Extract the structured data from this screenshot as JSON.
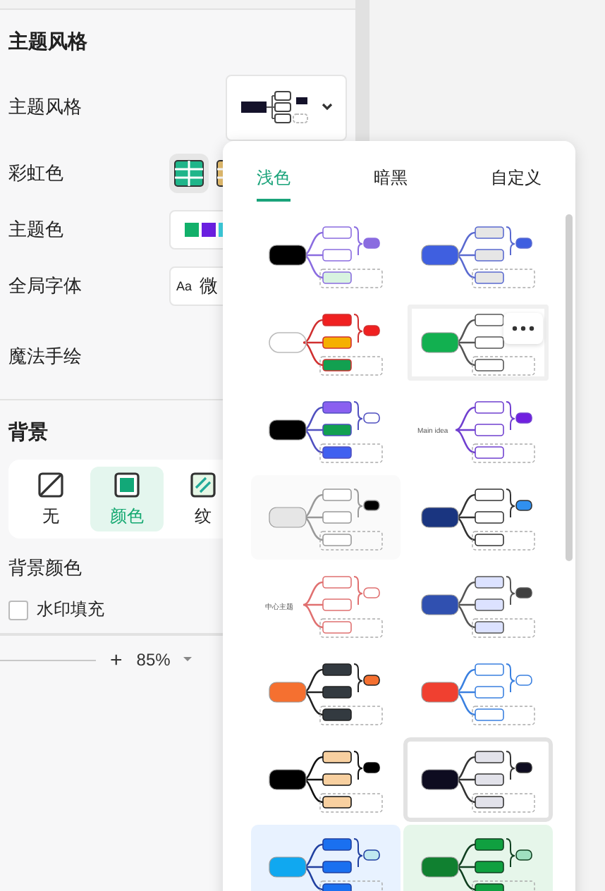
{
  "style_panel": {
    "heading": "主题风格",
    "theme_style": {
      "label": "主题风格"
    },
    "rainbow": {
      "label": "彩虹色",
      "options": [
        {
          "selected": true
        },
        {
          "selected": false
        }
      ]
    },
    "theme_color": {
      "label": "主题色",
      "swatches": [
        {
          "color": "#12b06a"
        },
        {
          "color": "#6a1fe0"
        },
        {
          "color": "#3dd0e0"
        }
      ]
    },
    "font": {
      "label": "全局字体",
      "icon": "Aa",
      "value": "微"
    },
    "hand_drawn": {
      "label": "魔法手绘"
    }
  },
  "background": {
    "heading": "背景",
    "options": [
      {
        "kind": "none",
        "label": "无",
        "selected": false
      },
      {
        "kind": "color",
        "label": "颜色",
        "selected": true
      },
      {
        "kind": "texture",
        "label": "纹",
        "selected": false
      }
    ],
    "color_label": "背景颜色",
    "watermark": {
      "label": "水印填充",
      "checked": false
    }
  },
  "zoom": {
    "plus": "+",
    "value": "85%"
  },
  "theme_popup": {
    "tabs": [
      {
        "label": "浅色",
        "selected": true
      },
      {
        "label": "暗黑",
        "selected": false
      },
      {
        "label": "自定义",
        "selected": false
      }
    ],
    "themes": [
      {
        "color": "#000000",
        "selected": false,
        "hovered": false
      },
      {
        "color": "#3f5fe0",
        "selected": false,
        "hovered": false
      },
      {
        "selected": false,
        "hovered": false
      },
      {
        "color": "#12b050",
        "selected": false,
        "hovered": true
      },
      {
        "color": "#000000",
        "selected": false,
        "hovered": false
      },
      {
        "label": "Main idea",
        "selected": false,
        "hovered": false
      },
      {
        "color": "#e6e6e6",
        "selected": false,
        "hovered": false
      },
      {
        "color": "#1a3580",
        "selected": false,
        "hovered": false
      },
      {
        "label": "中心主题",
        "selected": false,
        "hovered": false
      },
      {
        "color": "#3050b0",
        "selected": false,
        "hovered": false
      },
      {
        "color": "#f57030",
        "selected": false,
        "hovered": false
      },
      {
        "color": "#f04030",
        "selected": false,
        "hovered": false
      },
      {
        "color": "#000000",
        "selected": false,
        "hovered": false
      },
      {
        "color": "#0e0c20",
        "selected": true,
        "hovered": false
      },
      {
        "color": "#10a8f0",
        "selected": false,
        "hovered": false
      },
      {
        "color": "#108030",
        "selected": false,
        "hovered": false
      }
    ]
  }
}
